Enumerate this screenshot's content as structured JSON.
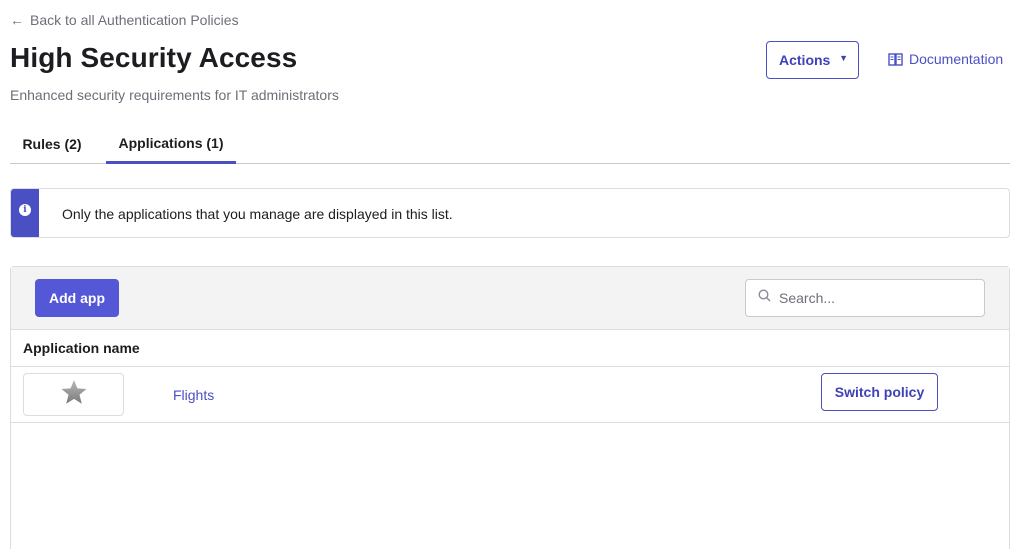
{
  "header": {
    "back_link": "Back to all Authentication Policies",
    "title": "High Security Access",
    "subtitle": "Enhanced security requirements for IT administrators",
    "actions_label": "Actions",
    "documentation_label": "Documentation"
  },
  "tabs": [
    {
      "label": "Rules (2)",
      "active": false
    },
    {
      "label": "Applications (1)",
      "active": true
    }
  ],
  "info_banner": {
    "message": "Only the applications that you manage are displayed in this list."
  },
  "toolbar": {
    "add_app_label": "Add app",
    "search_placeholder": "Search..."
  },
  "table": {
    "columns": [
      "Application name"
    ],
    "rows": [
      {
        "app_name": "Flights",
        "logo_icon": "star-icon",
        "action_label": "Switch policy"
      }
    ]
  },
  "colors": {
    "accent": "#4b4fc4",
    "primary_button": "#5457d6",
    "text": "#1d1d21",
    "muted_text": "#6e6e78"
  }
}
